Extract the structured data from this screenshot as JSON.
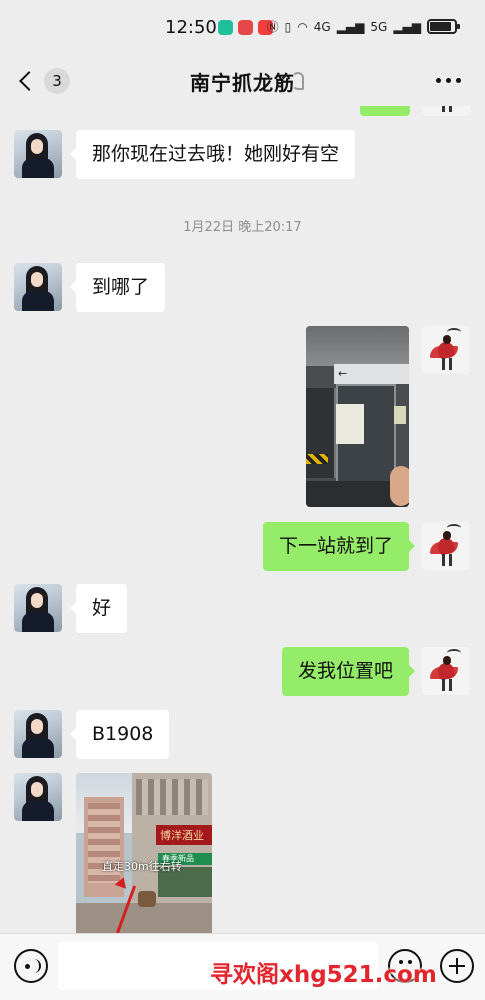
{
  "status_bar": {
    "time": "12:50",
    "network_label_1": "4G",
    "network_label_2": "5G",
    "app_icon_colors": [
      "#1fbf9a",
      "#e54848",
      "#f03e3e"
    ]
  },
  "nav": {
    "back_badge": "3",
    "title": "南宁抓龙筋"
  },
  "messages": [
    {
      "side": "in",
      "text": "那你现在过去哦！她刚好有空"
    },
    {
      "type": "time",
      "text": "1月22日 晚上20:17"
    },
    {
      "side": "in",
      "text": "到哪了"
    },
    {
      "side": "out",
      "type": "image",
      "caption": ""
    },
    {
      "side": "out",
      "text": "下一站就到了"
    },
    {
      "side": "in",
      "text": "好"
    },
    {
      "side": "out",
      "text": "发我位置吧"
    },
    {
      "side": "in",
      "text": "B1908"
    },
    {
      "side": "in",
      "type": "image",
      "caption": "直走30m往右转"
    }
  ],
  "photo_metro": {
    "sign_text": "←"
  },
  "photo_street": {
    "shop_sign": "博洋酒业",
    "green_sign": "春季新品",
    "caption": "直走30m往右转"
  },
  "input": {
    "placeholder": ""
  },
  "watermark": "寻欢阁xhg521.com",
  "colors": {
    "out_bubble": "#95ec69",
    "in_bubble": "#ffffff",
    "background": "#ededed"
  }
}
